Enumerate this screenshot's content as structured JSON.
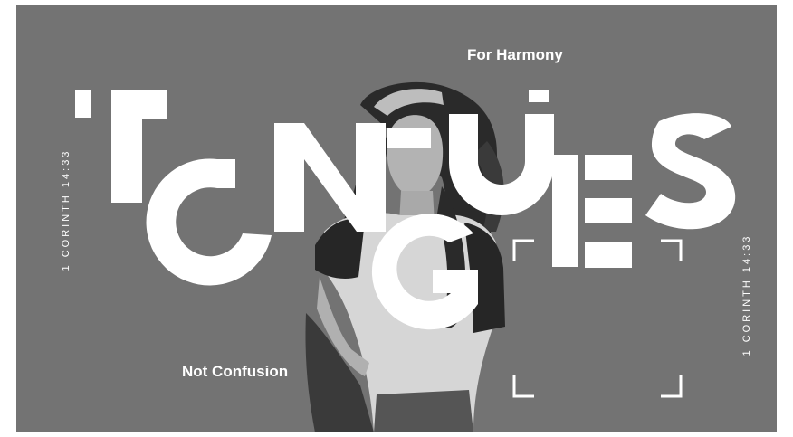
{
  "scripture_ref_left": "1 CORINTH 14:33",
  "scripture_ref_right": "1 CORINTH 14:33",
  "tagline_top": "For Harmony",
  "tagline_bottom": "Not Confusion",
  "title": "TONGUES",
  "colors": {
    "background": "#737373",
    "text": "#ffffff",
    "photo_dark": "#2b2b2b",
    "photo_mid": "#9a9a9a"
  }
}
